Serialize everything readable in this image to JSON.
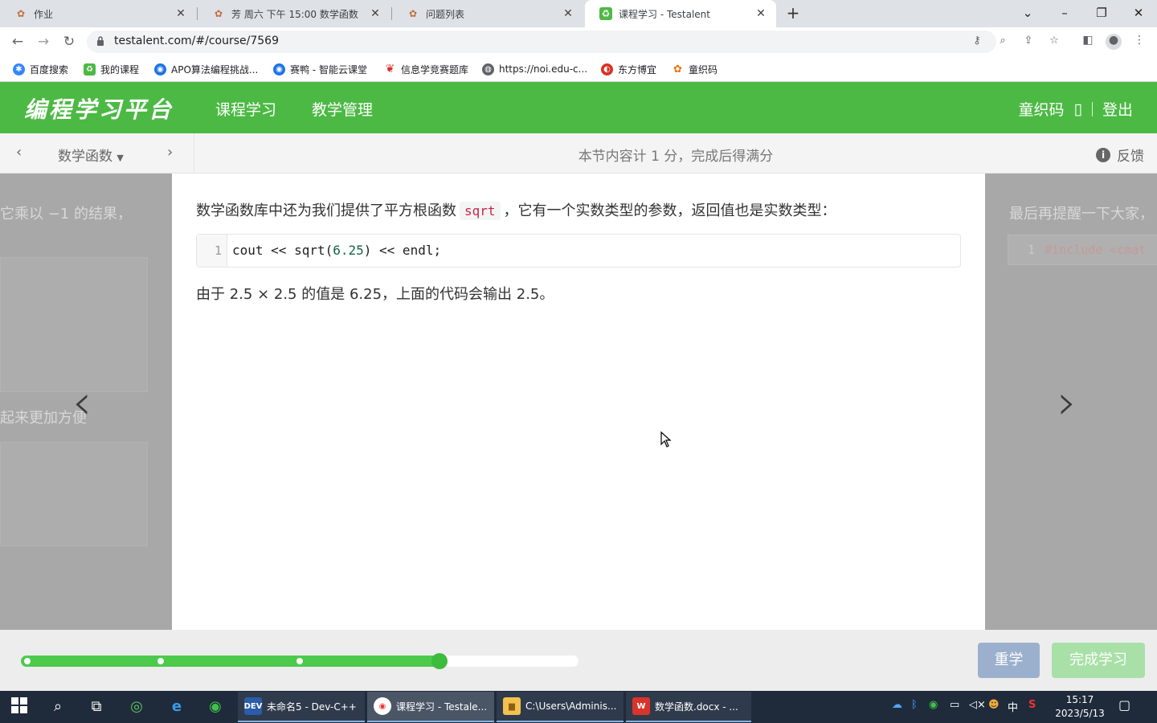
{
  "browser": {
    "tabs": [
      {
        "label": "作业",
        "favicon": "pepper-icon",
        "active": false
      },
      {
        "label": "芳 周六 下午 15:00 数学函数",
        "favicon": "pepper-icon",
        "active": false
      },
      {
        "label": "问题列表",
        "favicon": "pepper-icon",
        "active": false
      },
      {
        "label": "课程学习 - Testalent",
        "favicon": "testalent-icon",
        "active": true
      }
    ],
    "url": "testalent.com/#/course/7569",
    "bookmarks": [
      {
        "label": "百度搜索",
        "icon": "baidu-icon",
        "color": "#3385ff"
      },
      {
        "label": "我的课程",
        "icon": "testalent-icon",
        "color": "#4cb944"
      },
      {
        "label": "APO算法编程挑战...",
        "icon": "globe-icon",
        "color": "#1a73e8"
      },
      {
        "label": "赛鸭 - 智能云课堂",
        "icon": "globe-icon",
        "color": "#1a73e8"
      },
      {
        "label": "信息学竞赛题库",
        "icon": "leaf-icon",
        "color": "#d93025"
      },
      {
        "label": "https://noi.edu-c...",
        "icon": "globe-icon",
        "color": "#5f6368"
      },
      {
        "label": "东方博宜",
        "icon": "swirl-icon",
        "color": "#d93025"
      },
      {
        "label": "童织码",
        "icon": "pepper-icon",
        "color": "#e8710a"
      }
    ]
  },
  "app": {
    "logo": "编程学习平台",
    "nav": [
      "课程学习",
      "教学管理"
    ],
    "user": "童织码",
    "user_icon": "▯",
    "logout": "登出",
    "brand_color": "#4cb944"
  },
  "subbar": {
    "section": "数学函数",
    "info": "本节内容计 1 分，完成后得满分",
    "feedback": "反馈"
  },
  "content": {
    "p1_before": "数学函数库中还为我们提供了平方根函数",
    "p1_code": "sqrt",
    "p1_after": "，它有一个实数类型的参数，返回值也是实数类型：",
    "code_line_no": "1",
    "code_pre": "cout << sqrt(",
    "code_num": "6.25",
    "code_post": ") << endl;",
    "p2": "由于 2.5 × 2.5 的值是 6.25，上面的代码会输出 2.5。",
    "prev_text1": "它乘以 −1 的结果，",
    "prev_text2": "起来更加方便",
    "next_text": "最后再提醒一下大家，",
    "next_code_no": "1",
    "next_code": "#include <cmat"
  },
  "progress": {
    "fraction": 0.75,
    "dots": 3
  },
  "buttons": {
    "relearn": "重学",
    "complete": "完成学习"
  },
  "taskbar": {
    "apps": [
      {
        "label": "未命名5 - Dev-C++",
        "icon": "devcpp-icon"
      },
      {
        "label": "课程学习 - Testale...",
        "icon": "chrome-icon"
      },
      {
        "label": "C:\\Users\\Adminis...",
        "icon": "folder-icon"
      },
      {
        "label": "数学函数.docx - ...",
        "icon": "wps-icon"
      }
    ],
    "ime": "中",
    "time": "15:17",
    "date": "2023/5/13"
  }
}
